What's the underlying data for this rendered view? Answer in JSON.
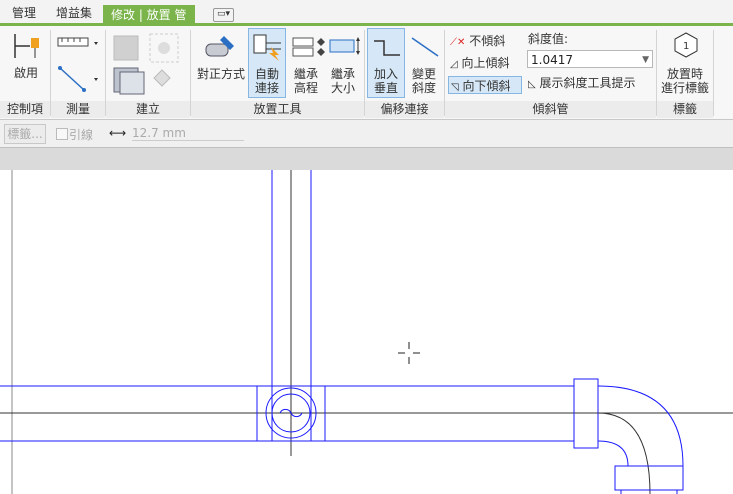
{
  "tabs": [
    {
      "label": "管理"
    },
    {
      "label": "增益集"
    },
    {
      "label": "修改 | 放置 管"
    }
  ],
  "ribbon": {
    "control": {
      "activate_label": "啟用",
      "title": "控制項"
    },
    "measure": {
      "title": "測量"
    },
    "create": {
      "title": "建立"
    },
    "placement": {
      "align_label": "對正方式",
      "auto_connect_line1": "自動",
      "auto_connect_line2": "連接",
      "inherit_elev_line1": "繼承",
      "inherit_elev_line2": "高程",
      "inherit_size_line1": "繼承",
      "inherit_size_line2": "大小",
      "title": "放置工具"
    },
    "offset": {
      "add_vertical_line1": "加入",
      "add_vertical_line2": "垂直",
      "change_slope_line1": "變更",
      "change_slope_line2": "斜度",
      "title": "偏移連接"
    },
    "slope": {
      "no_slope": "不傾斜",
      "slope_up": "向上傾斜",
      "slope_down": "向下傾斜",
      "value_label": "斜度值:",
      "value": "1.0417",
      "show_tooltip": "展示斜度工具提示",
      "title": "傾斜管"
    },
    "tag": {
      "tag_on_place_line1": "放置時",
      "tag_on_place_line2": "進行標籤",
      "badge": "1",
      "title": "標籤"
    }
  },
  "options": {
    "tag_button": "標籤...",
    "leader_label": "引線",
    "length_value": "12.7 mm"
  },
  "colors": {
    "accent": "#7ab44a",
    "pipe": "#1a1aff",
    "selected": "#d6e8f7"
  }
}
